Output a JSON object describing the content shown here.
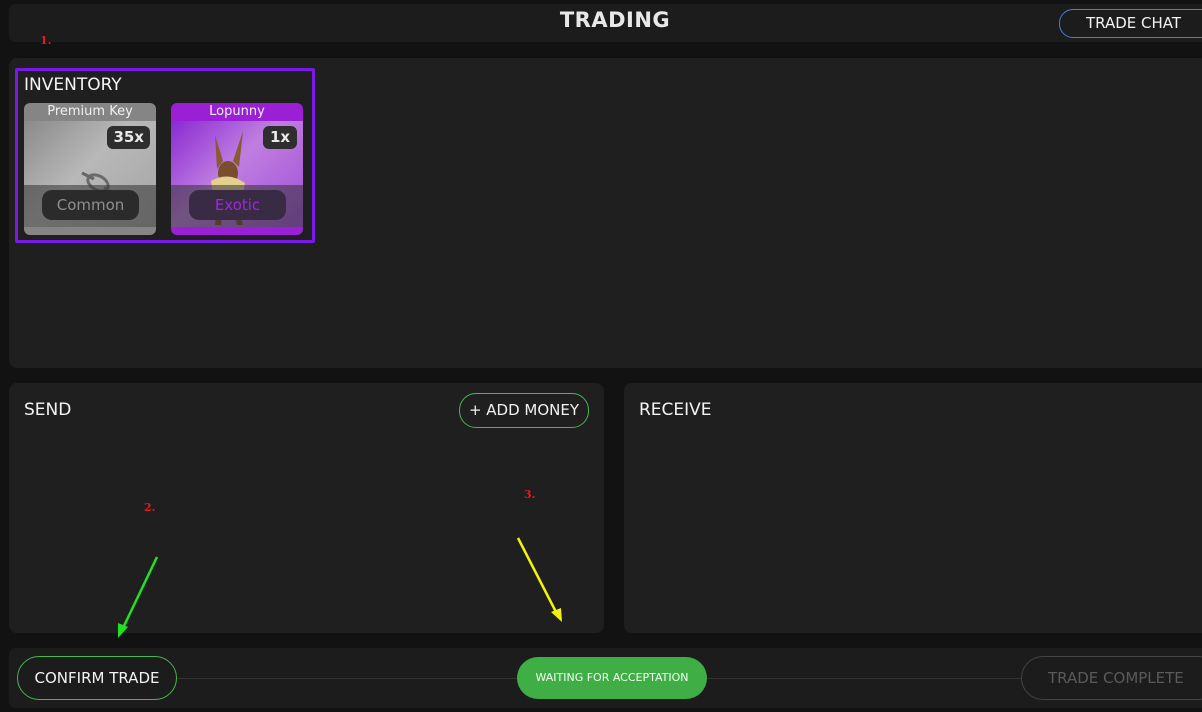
{
  "header": {
    "title": "TRADING",
    "trade_chat_label": "TRADE CHAT"
  },
  "annotations": {
    "one": "1.",
    "two": "2.",
    "three": "3."
  },
  "inventory": {
    "title": "INVENTORY",
    "items": [
      {
        "name": "Premium Key",
        "count": "35x",
        "rarity": "Common",
        "icon": "key-icon"
      },
      {
        "name": "Lopunny",
        "count": "1x",
        "rarity": "Exotic",
        "icon": "lopunny-icon"
      }
    ]
  },
  "send": {
    "title": "SEND",
    "add_money_label": "+ ADD MONEY"
  },
  "receive": {
    "title": "RECEIVE"
  },
  "footer": {
    "confirm_label": "CONFIRM TRADE",
    "status_label": "WAITING FOR ACCEPTATION",
    "complete_label": "TRADE COMPLETE"
  },
  "colors": {
    "accent_green": "#46b84c",
    "highlight_purple": "#7a18e6",
    "annotation_red": "#e21b1b",
    "arrow_green": "#22e022",
    "arrow_yellow": "#f2f20f"
  }
}
